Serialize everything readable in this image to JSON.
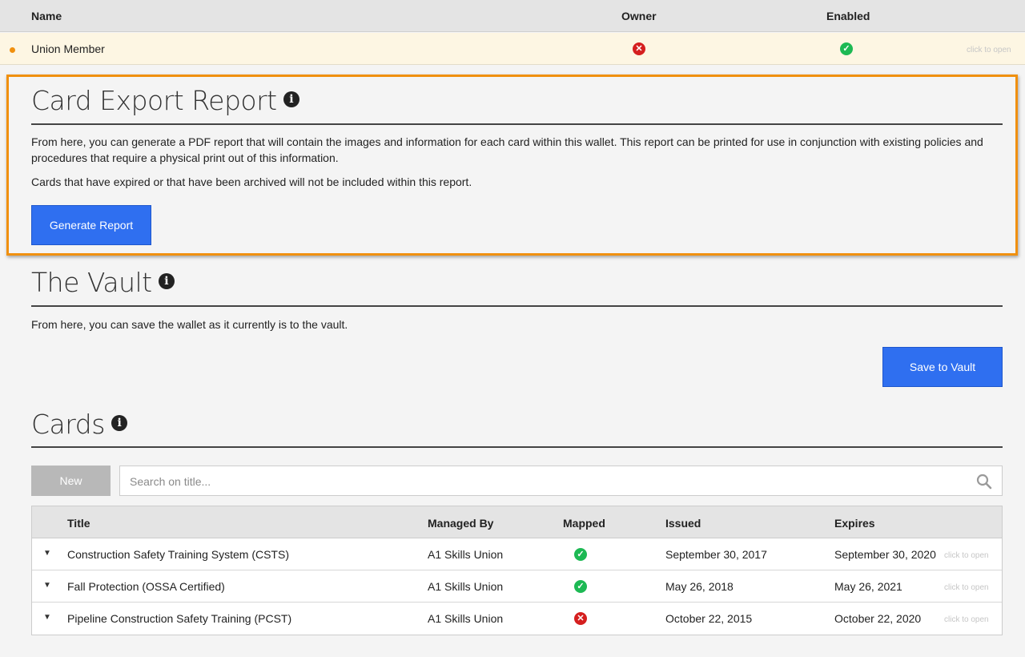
{
  "top_table": {
    "headers": {
      "name": "Name",
      "owner": "Owner",
      "enabled": "Enabled"
    },
    "row": {
      "name": "Union Member",
      "owner": "no",
      "enabled": "yes",
      "action": "click to open"
    }
  },
  "export_report": {
    "title": "Card Export Report",
    "description1": "From here, you can generate a PDF report that will contain the images and information for each card within this wallet. This report can be printed for use in conjunction with existing policies and procedures that require a physical print out of this information.",
    "description2": "Cards that have expired or that have been archived will not be included within this report.",
    "button": "Generate Report"
  },
  "vault": {
    "title": "The Vault",
    "description": "From here, you can save the wallet as it currently is to the vault.",
    "button": "Save to Vault"
  },
  "cards": {
    "title": "Cards",
    "new_button": "New",
    "search_placeholder": "Search on title...",
    "headers": {
      "title": "Title",
      "managed_by": "Managed By",
      "mapped": "Mapped",
      "issued": "Issued",
      "expires": "Expires"
    },
    "rows": [
      {
        "title": "Construction Safety Training System (CSTS)",
        "managed_by": "A1 Skills Union",
        "mapped": "yes",
        "issued": "September 30, 2017",
        "expires": "September 30, 2020",
        "action": "click to open"
      },
      {
        "title": "Fall Protection (OSSA Certified)",
        "managed_by": "A1 Skills Union",
        "mapped": "yes",
        "issued": "May 26, 2018",
        "expires": "May 26, 2021",
        "action": "click to open"
      },
      {
        "title": "Pipeline Construction Safety Training (PCST)",
        "managed_by": "A1 Skills Union",
        "mapped": "no",
        "issued": "October 22, 2015",
        "expires": "October 22, 2020",
        "action": "click to open"
      }
    ]
  },
  "colors": {
    "accent": "#2f6ff0",
    "highlight": "#f0900f",
    "ok": "#1db954",
    "error": "#d51f1f"
  },
  "icons": {
    "ok": "check-circle-icon",
    "no": "x-circle-icon",
    "info": "info-icon",
    "search": "search-icon"
  }
}
